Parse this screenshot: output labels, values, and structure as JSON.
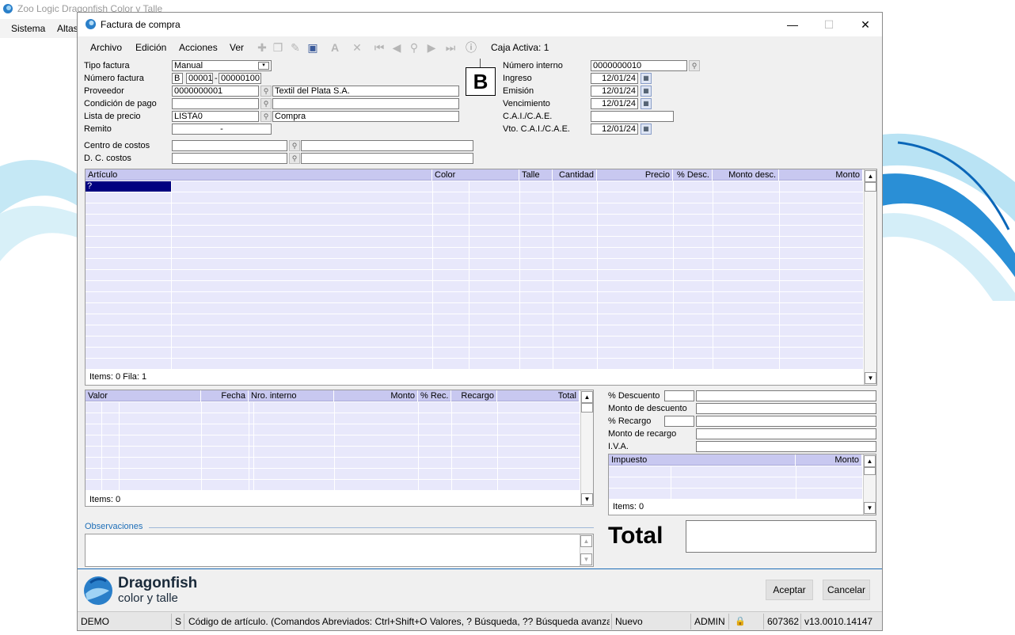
{
  "app": {
    "title": "Zoo Logic Dragonfish Color y Talle",
    "menu": [
      "Sistema",
      "Altas"
    ]
  },
  "window": {
    "title": "Factura de compra",
    "minimize": "—",
    "maximize": "☐",
    "close": "✕"
  },
  "toolbar": {
    "menu": [
      {
        "label": "Archivo"
      },
      {
        "label": "Edición"
      },
      {
        "label": "Acciones"
      },
      {
        "label": "Ver"
      }
    ],
    "caja": "Caja Activa: 1"
  },
  "form": {
    "tipo_factura_label": "Tipo factura",
    "tipo_factura_value": "Manual",
    "numero_factura_label": "Número factura",
    "numero_letra": "B",
    "numero_pv": "00001",
    "numero_nro": "00000100",
    "proveedor_label": "Proveedor",
    "proveedor_code": "0000000001",
    "proveedor_name": "Textil del Plata S.A.",
    "condicion_label": "Condición de pago",
    "lista_label": "Lista de precio",
    "lista_code": "LISTA0",
    "lista_name": "Compra",
    "remito_label": "Remito",
    "remito_value": "-",
    "centro_label": "Centro de costos",
    "dc_label": "D. C. costos",
    "letter": "B",
    "numero_interno_label": "Número interno",
    "numero_interno_value": "0000000010",
    "ingreso_label": "Ingreso",
    "ingreso_value": "12/01/24",
    "emision_label": "Emisión",
    "emision_value": "12/01/24",
    "vencimiento_label": "Vencimiento",
    "vencimiento_value": "12/01/24",
    "cai_label": "C.A.I./C.A.E.",
    "vto_cai_label": "Vto. C.A.I./C.A.E.",
    "vto_cai_value": "12/01/24"
  },
  "articles_grid": {
    "columns": [
      "Artículo",
      "Color",
      "Talle",
      "Cantidad",
      "Precio",
      "% Desc.",
      "Monto desc.",
      "Monto"
    ],
    "first_cell": "?",
    "footer": "Items: 0    Fila: 1"
  },
  "values_grid": {
    "columns": [
      "Valor",
      "Fecha",
      "Nro. interno",
      "Monto",
      "% Rec.",
      "Recargo",
      "Total"
    ],
    "footer": "Items: 0"
  },
  "totals": {
    "pct_descuento": "% Descuento",
    "monto_descuento": "Monto de descuento",
    "pct_recargo": "% Recargo",
    "monto_recargo": "Monto de recargo",
    "iva": "I.V.A.",
    "tax_columns": [
      "Impuesto",
      "Monto"
    ],
    "tax_footer": "Items: 0",
    "total_label": "Total"
  },
  "observaciones": "Observaciones",
  "brand": {
    "name": "Dragonfish",
    "tagline": "color y talle"
  },
  "buttons": {
    "aceptar": "Aceptar",
    "cancelar": "Cancelar"
  },
  "status": {
    "mode": "DEMO",
    "s": "S",
    "hint": "Código de artículo. (Comandos Abreviados: Ctrl+Shift+O Valores, ? Búsqueda, ?? Búsqueda avanzada, + Alta re",
    "state": "Nuevo",
    "user": "ADMIN",
    "num": "607362",
    "version": "v13.0010.14147"
  },
  "colors": {
    "grid_header": "#c8c8f0",
    "grid_row": "#e8e8fb",
    "selected_cell": "#000080"
  }
}
